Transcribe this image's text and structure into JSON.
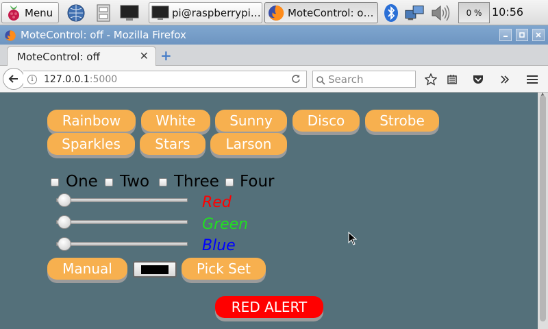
{
  "taskbar": {
    "menu_label": "Menu",
    "tasks": [
      {
        "label": "pi@raspberrypi: ..."
      },
      {
        "label": "MoteControl: off ..."
      }
    ],
    "cpu_usage": "0 %",
    "clock": "10:56"
  },
  "window": {
    "title": "MoteControl: off - Mozilla Firefox"
  },
  "tabs": [
    {
      "title": "MoteControl: off"
    }
  ],
  "navbar": {
    "url_host": "127.0.0.1",
    "url_port": ":5000",
    "search_placeholder": "Search"
  },
  "page": {
    "mode_buttons": [
      "Rainbow",
      "White",
      "Sunny",
      "Disco",
      "Strobe",
      "Sparkles",
      "Stars",
      "Larson"
    ],
    "channels": [
      {
        "label": "One",
        "checked": false
      },
      {
        "label": "Two",
        "checked": false
      },
      {
        "label": "Three",
        "checked": false
      },
      {
        "label": "Four",
        "checked": false
      }
    ],
    "sliders": [
      {
        "label": "Red",
        "value": 0,
        "color": "#ff0000"
      },
      {
        "label": "Green",
        "value": 0,
        "color": "#22dd22"
      },
      {
        "label": "Blue",
        "value": 0,
        "color": "#0000ff"
      }
    ],
    "manual_label": "Manual",
    "pick_set_label": "Pick Set",
    "picked_color": "#000000",
    "red_alert_label": "RED ALERT"
  },
  "colors": {
    "button": "#f7b04f",
    "alert": "#ff0000",
    "page_background": "#54707a"
  }
}
